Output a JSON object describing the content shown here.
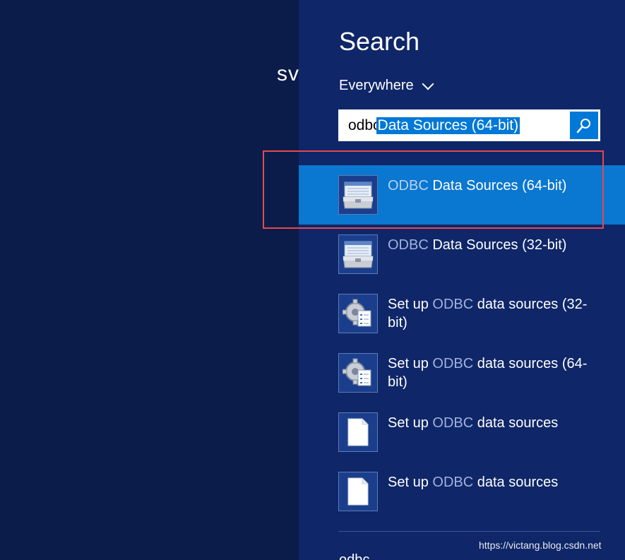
{
  "background_label": "sv",
  "search": {
    "title": "Search",
    "scope": "Everywhere",
    "query_typed": "odbc",
    "query_autocomplete": "Data Sources (64-bit)"
  },
  "results": [
    {
      "highlight": "ODBC",
      "rest": " Data Sources (64-bit)",
      "prefix": "",
      "icon": "toolbox-icon"
    },
    {
      "highlight": "ODBC",
      "rest": " Data Sources (32-bit)",
      "prefix": "",
      "icon": "toolbox-icon"
    },
    {
      "prefix": "Set up ",
      "highlight": "ODBC",
      "rest": " data sources (32-bit)",
      "icon": "gear-checklist-icon"
    },
    {
      "prefix": "Set up ",
      "highlight": "ODBC",
      "rest": " data sources (64-bit)",
      "icon": "gear-checklist-icon"
    },
    {
      "prefix": "Set up ",
      "highlight": "ODBC",
      "rest": " data sources",
      "icon": "document-icon"
    },
    {
      "prefix": "Set up ",
      "highlight": "ODBC",
      "rest": " data sources",
      "icon": "document-icon"
    }
  ],
  "footer_query": "odbc",
  "watermark": "https://victang.blog.csdn.net",
  "colors": {
    "panel": "#0f2668",
    "background": "#0b1c4a",
    "accent": "#0078d7",
    "annotation": "#e5484e"
  }
}
